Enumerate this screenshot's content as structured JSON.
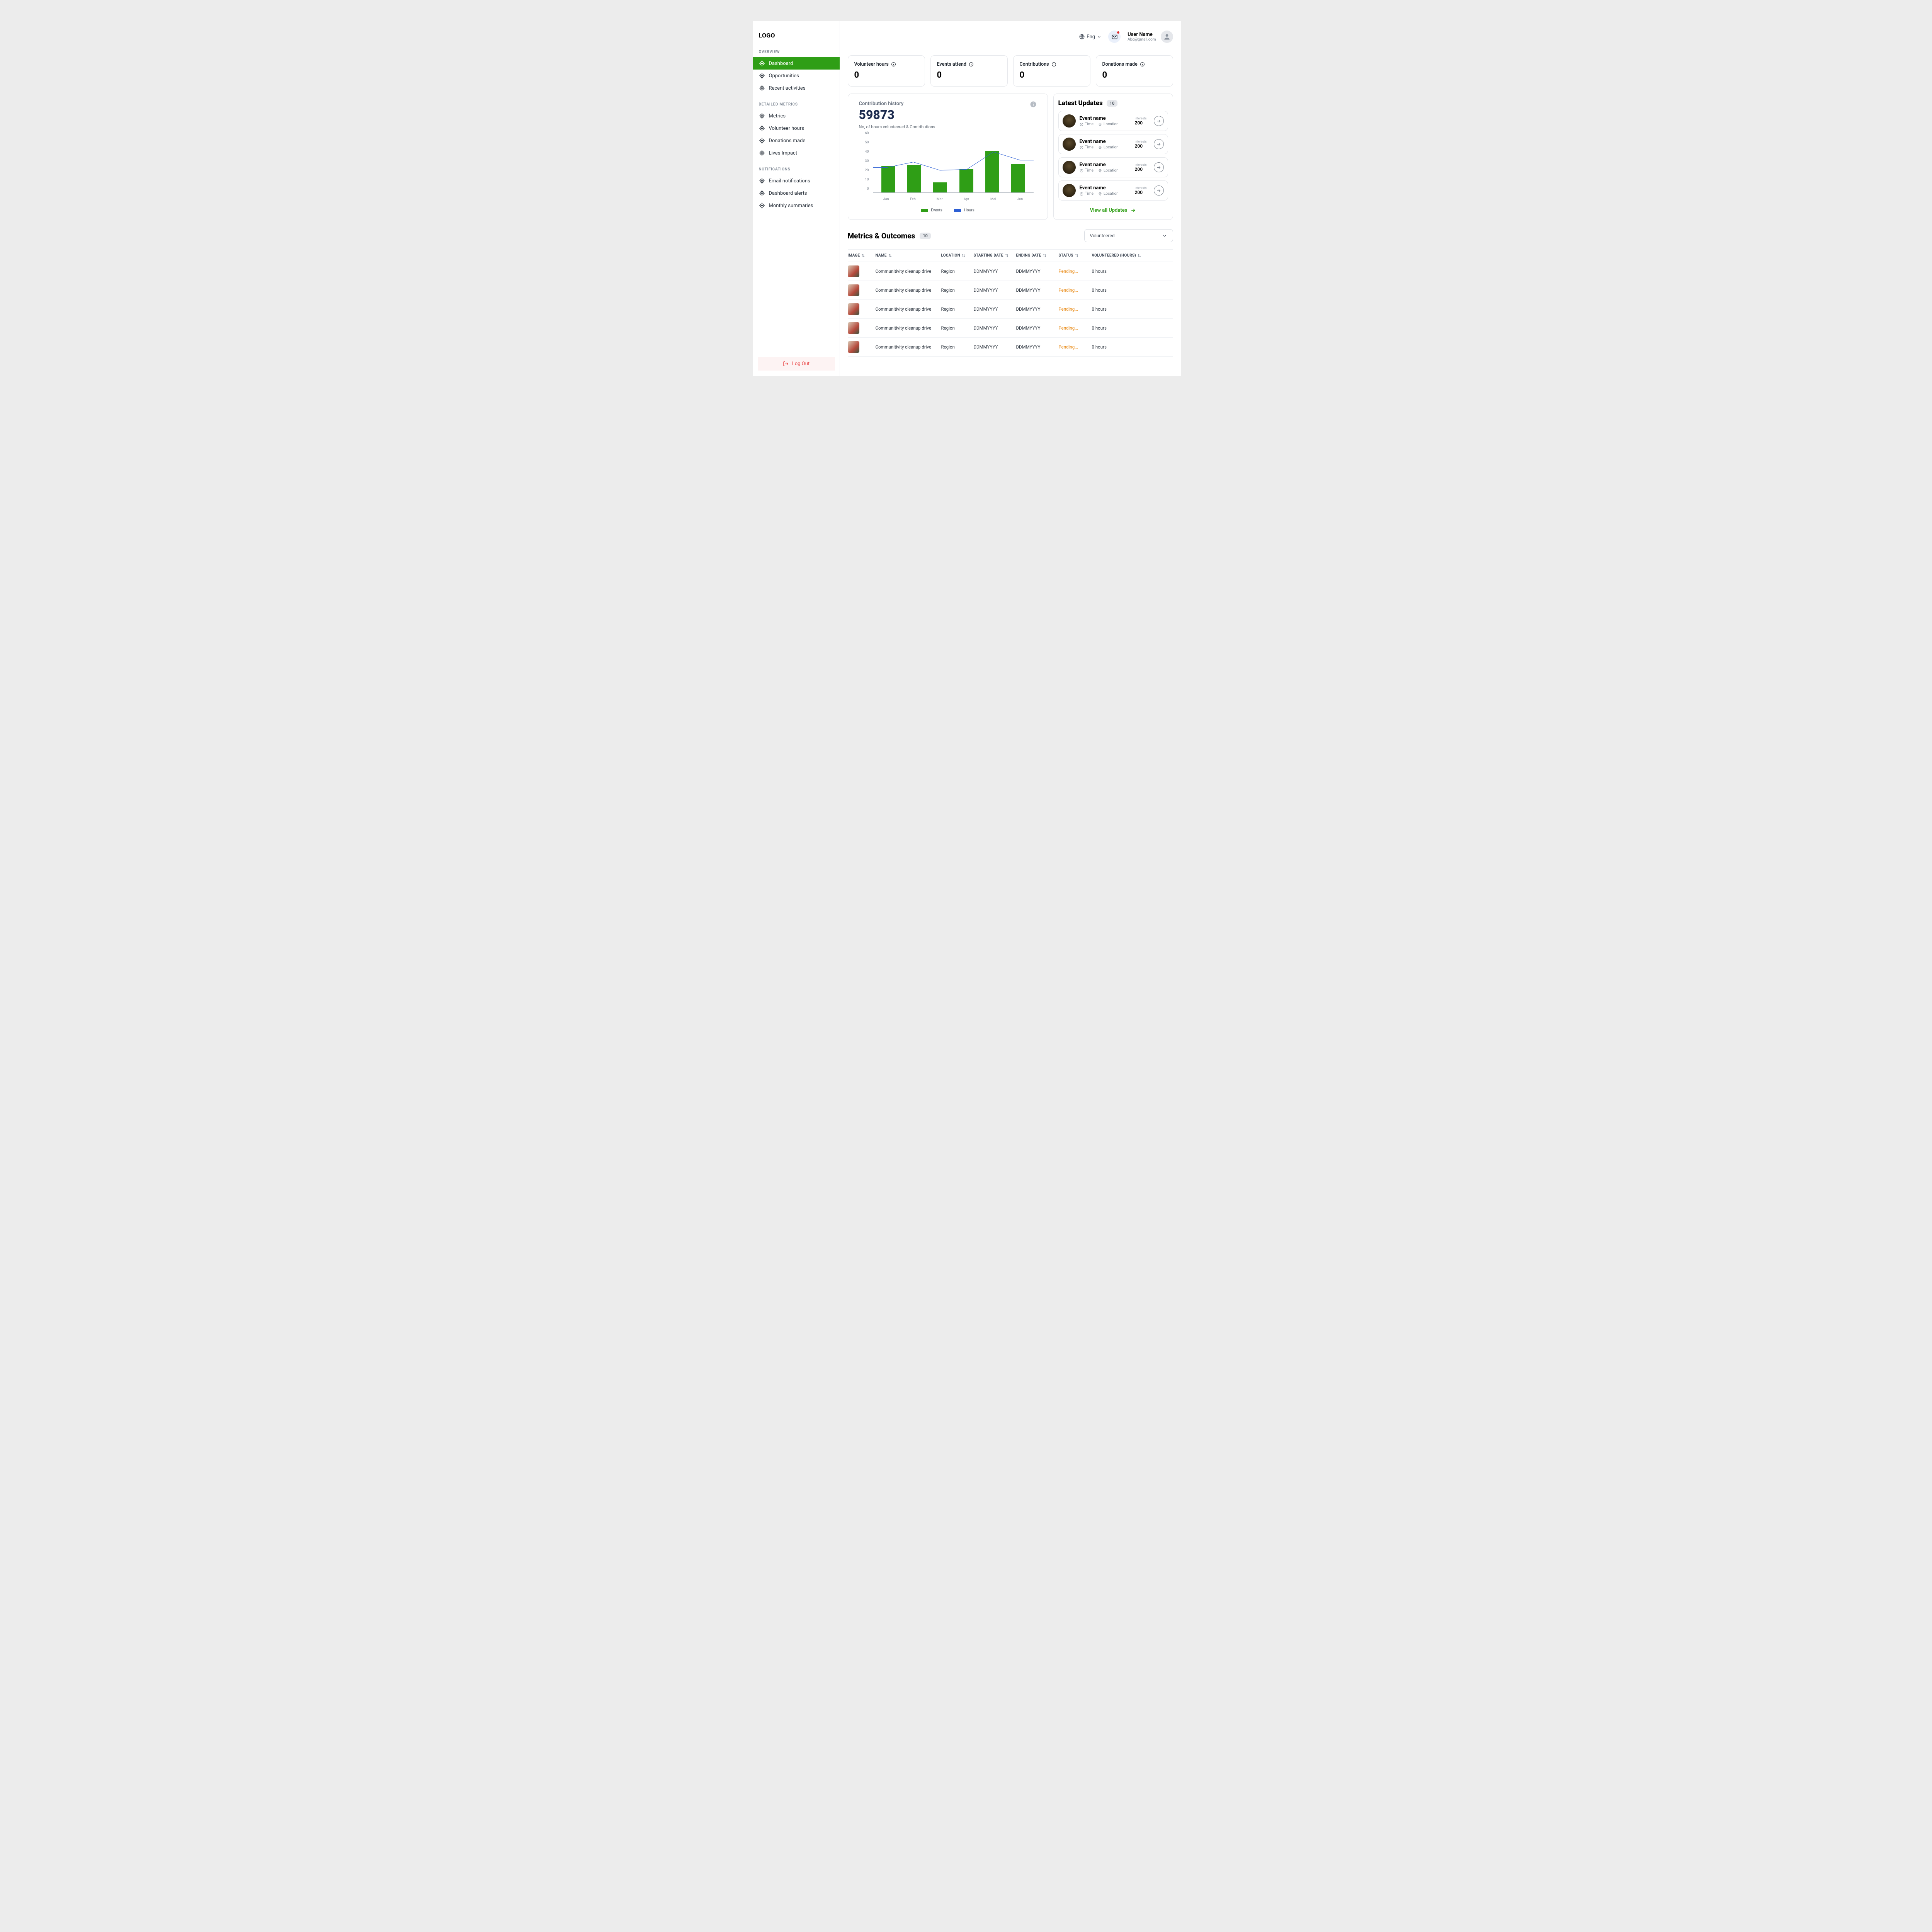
{
  "logo": "LOGO",
  "sidebar": {
    "sections": [
      {
        "label": "OVERVIEW",
        "items": [
          {
            "label": "Dashboard",
            "active": true
          },
          {
            "label": "Opportunities"
          },
          {
            "label": "Recent activities"
          }
        ]
      },
      {
        "label": "DETAILED METRICS",
        "items": [
          {
            "label": "Metrics"
          },
          {
            "label": "Volunteer hours"
          },
          {
            "label": "Donations made"
          },
          {
            "label": "Lives Impact"
          }
        ]
      },
      {
        "label": "NOTIFICATIONS",
        "items": [
          {
            "label": "Email notifications"
          },
          {
            "label": "Dashboard alerts"
          },
          {
            "label": "Monthly summaries"
          }
        ]
      }
    ],
    "logout": "Log Out"
  },
  "topbar": {
    "lang": "Eng",
    "user_name": "User Name",
    "user_email": "Abc@gmail.com"
  },
  "cards": [
    {
      "title": "Volunteer hours",
      "value": "0"
    },
    {
      "title": "Events attend",
      "value": "0"
    },
    {
      "title": "Contributions",
      "value": "0"
    },
    {
      "title": "Donations made",
      "value": "0"
    }
  ],
  "history": {
    "title": "Contribution history",
    "big": "59873",
    "sub": "No, of hours volunteered & Contributions",
    "legend": [
      {
        "label": "Events",
        "color": "#2f9e16"
      },
      {
        "label": "Hours",
        "color": "#2d5fd4"
      }
    ]
  },
  "chart_data": {
    "type": "bar",
    "categories": [
      "Jan",
      "Feb",
      "Mar",
      "Apr",
      "Mai",
      "Jun"
    ],
    "series": [
      {
        "name": "Events",
        "type": "bar",
        "values": [
          29,
          30,
          11,
          25,
          45,
          31
        ],
        "color": "#2f9e16"
      },
      {
        "name": "Hours",
        "type": "line",
        "values": [
          27,
          33,
          24,
          25,
          44,
          35
        ],
        "color": "#2d5fd4"
      }
    ],
    "ylim": [
      0,
      60
    ],
    "yticks": [
      0,
      10,
      20,
      30,
      40,
      50,
      60
    ]
  },
  "updates": {
    "title": "Latest Updates",
    "count": "10",
    "items": [
      {
        "name": "Event name",
        "time": "Time",
        "loc": "Location",
        "interests_label": "interests",
        "interests": "200"
      },
      {
        "name": "Event name",
        "time": "Time",
        "loc": "Location",
        "interests_label": "interests",
        "interests": "200"
      },
      {
        "name": "Event name",
        "time": "Time",
        "loc": "Location",
        "interests_label": "interests",
        "interests": "200"
      },
      {
        "name": "Event name",
        "time": "Time",
        "loc": "Location",
        "interests_label": "interests",
        "interests": "200"
      }
    ],
    "view_all": "View all Updates"
  },
  "metrics": {
    "title": "Metrics & Outcomes",
    "count": "10",
    "select": "Volunteered",
    "columns": [
      "IMAGE",
      "NAME",
      "LOCATION",
      "STARTING DATE",
      "ENDING DATE",
      "STATUS",
      "VOLUNTEERED (HOURS)"
    ],
    "rows": [
      {
        "name": "Communitivity cleanup drive",
        "loc": "Region",
        "start": "DDMMYYYY",
        "end": "DDMMYYYY",
        "status": "Pending...",
        "hours": "0 hours"
      },
      {
        "name": "Communitivity cleanup drive",
        "loc": "Region",
        "start": "DDMMYYYY",
        "end": "DDMMYYYY",
        "status": "Pending...",
        "hours": "0 hours"
      },
      {
        "name": "Communitivity cleanup drive",
        "loc": "Region",
        "start": "DDMMYYYY",
        "end": "DDMMYYYY",
        "status": "Pending...",
        "hours": "0 hours"
      },
      {
        "name": "Communitivity cleanup drive",
        "loc": "Region",
        "start": "DDMMYYYY",
        "end": "DDMMYYYY",
        "status": "Pending...",
        "hours": "0 hours"
      },
      {
        "name": "Communitivity cleanup drive",
        "loc": "Region",
        "start": "DDMMYYYY",
        "end": "DDMMYYYY",
        "status": "Pending...",
        "hours": "0 hours"
      }
    ]
  }
}
